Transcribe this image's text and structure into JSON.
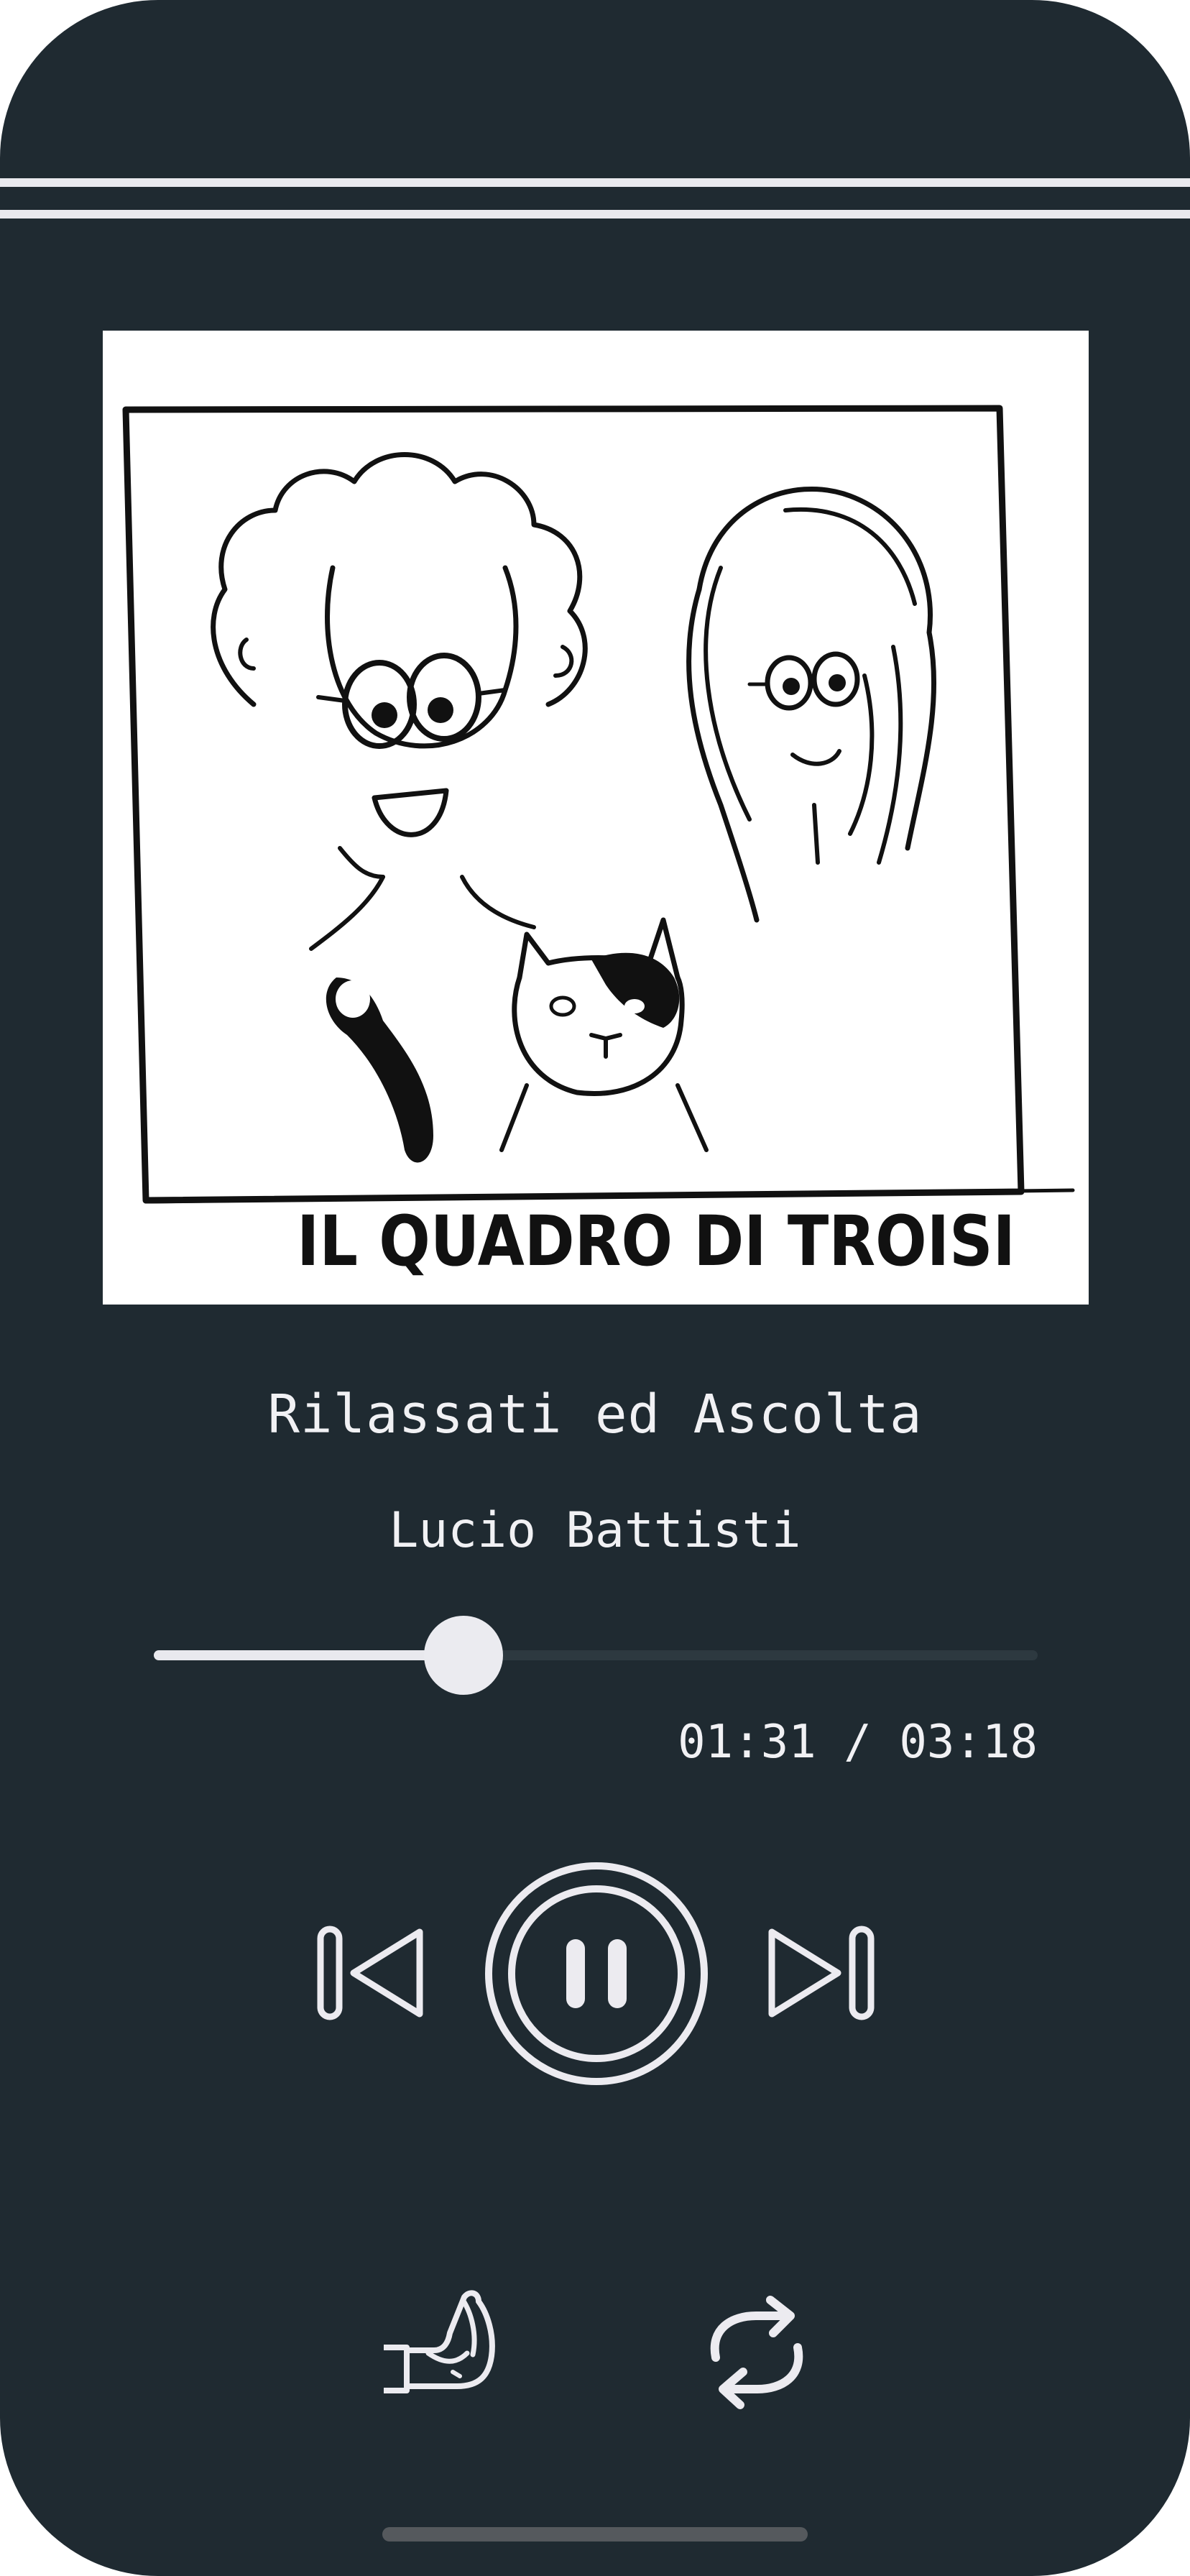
{
  "player": {
    "track_title": "Rilassati ed Ascolta",
    "artist": "Lucio Battisti",
    "elapsed": "01:31",
    "separator": " / ",
    "duration": "03:18",
    "progress_fraction": 0.35,
    "state": "playing"
  },
  "album_art": {
    "caption": "IL QUADRO DI TROISI"
  },
  "controls": {
    "previous_icon": "skip-previous-icon",
    "pause_icon": "pause-icon",
    "next_icon": "skip-next-icon",
    "like_icon": "hand-thumb-icon",
    "repeat_icon": "repeat-icon"
  },
  "colors": {
    "background": "#1f2a31",
    "foreground": "#f1f1f4",
    "track_inactive": "#2d3940"
  }
}
